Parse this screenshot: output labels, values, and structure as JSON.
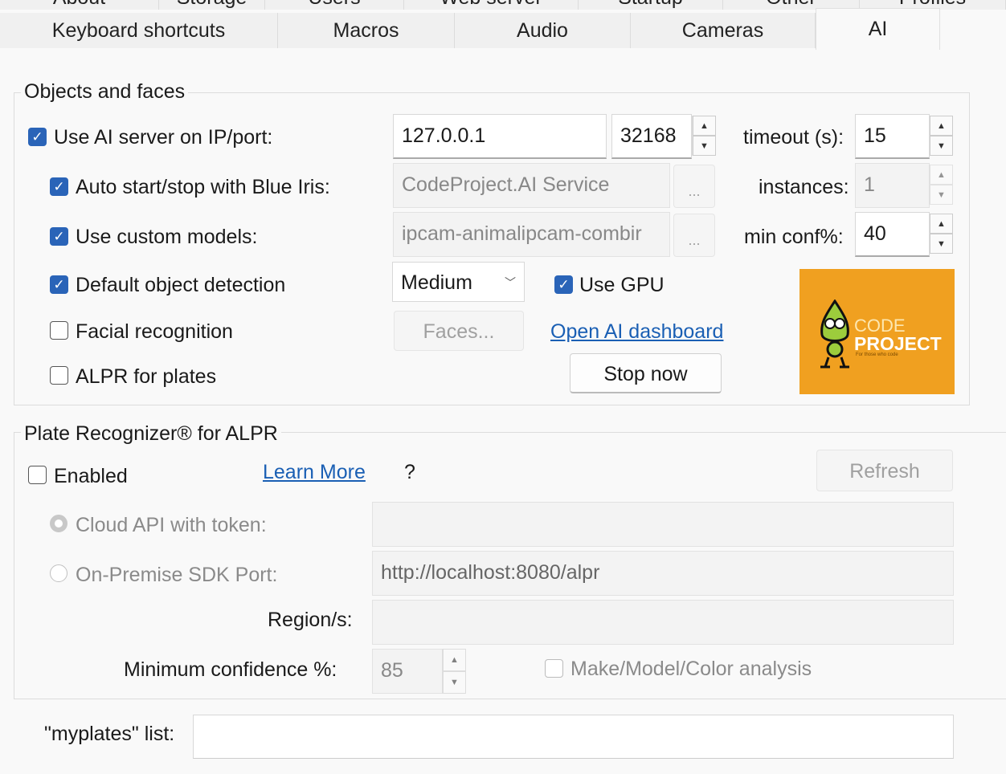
{
  "tabs_row1": [
    "About",
    "Storage",
    "Users",
    "Web server",
    "Startup",
    "Other",
    "Profiles"
  ],
  "tabs_row2": [
    "Keyboard shortcuts",
    "Macros",
    "Audio",
    "Cameras",
    "AI"
  ],
  "objects": {
    "title": "Objects and faces",
    "use_ai_server": {
      "label": "Use AI server on IP/port:",
      "checked": true
    },
    "ip": "127.0.0.1",
    "port": "32168",
    "timeout_label": "timeout (s):",
    "timeout": "15",
    "auto_start": {
      "label": "Auto start/stop with Blue Iris:",
      "checked": true
    },
    "service": "CodeProject.AI Service",
    "instances_label": "instances:",
    "instances": "1",
    "custom_models": {
      "label": "Use custom models:",
      "checked": true
    },
    "models": "ipcam-animalipcam-combir",
    "min_conf_label": "min conf%:",
    "min_conf": "40",
    "ellipsis": "...",
    "default_detection": {
      "label": "Default object detection",
      "checked": true
    },
    "detection_mode": "Medium",
    "use_gpu": {
      "label": "Use GPU",
      "checked": true
    },
    "facial": {
      "label": "Facial recognition",
      "checked": false
    },
    "faces_button": "Faces...",
    "dashboard_link": "Open AI dashboard",
    "alpr": {
      "label": "ALPR for plates",
      "checked": false
    },
    "stop_button": "Stop now",
    "logo": {
      "text1": "CODE",
      "text2": "PROJECT",
      "tagline": "For those who code",
      "color": "#f0a020"
    }
  },
  "plate": {
    "title": "Plate Recognizer® for ALPR",
    "enabled": {
      "label": "Enabled",
      "checked": false
    },
    "learn_more": "Learn More",
    "help": "?",
    "refresh": "Refresh",
    "cloud_label": "Cloud API with token:",
    "cloud_token": "",
    "sdk_label": "On-Premise SDK Port:",
    "sdk_url": "http://localhost:8080/alpr",
    "region_label": "Region/s:",
    "region": "",
    "min_conf_label": "Minimum confidence %:",
    "min_conf": "85",
    "mmc": {
      "label": "Make/Model/Color analysis",
      "checked": false
    }
  },
  "myplates": {
    "label": "\"myplates\" list:",
    "value": ""
  }
}
